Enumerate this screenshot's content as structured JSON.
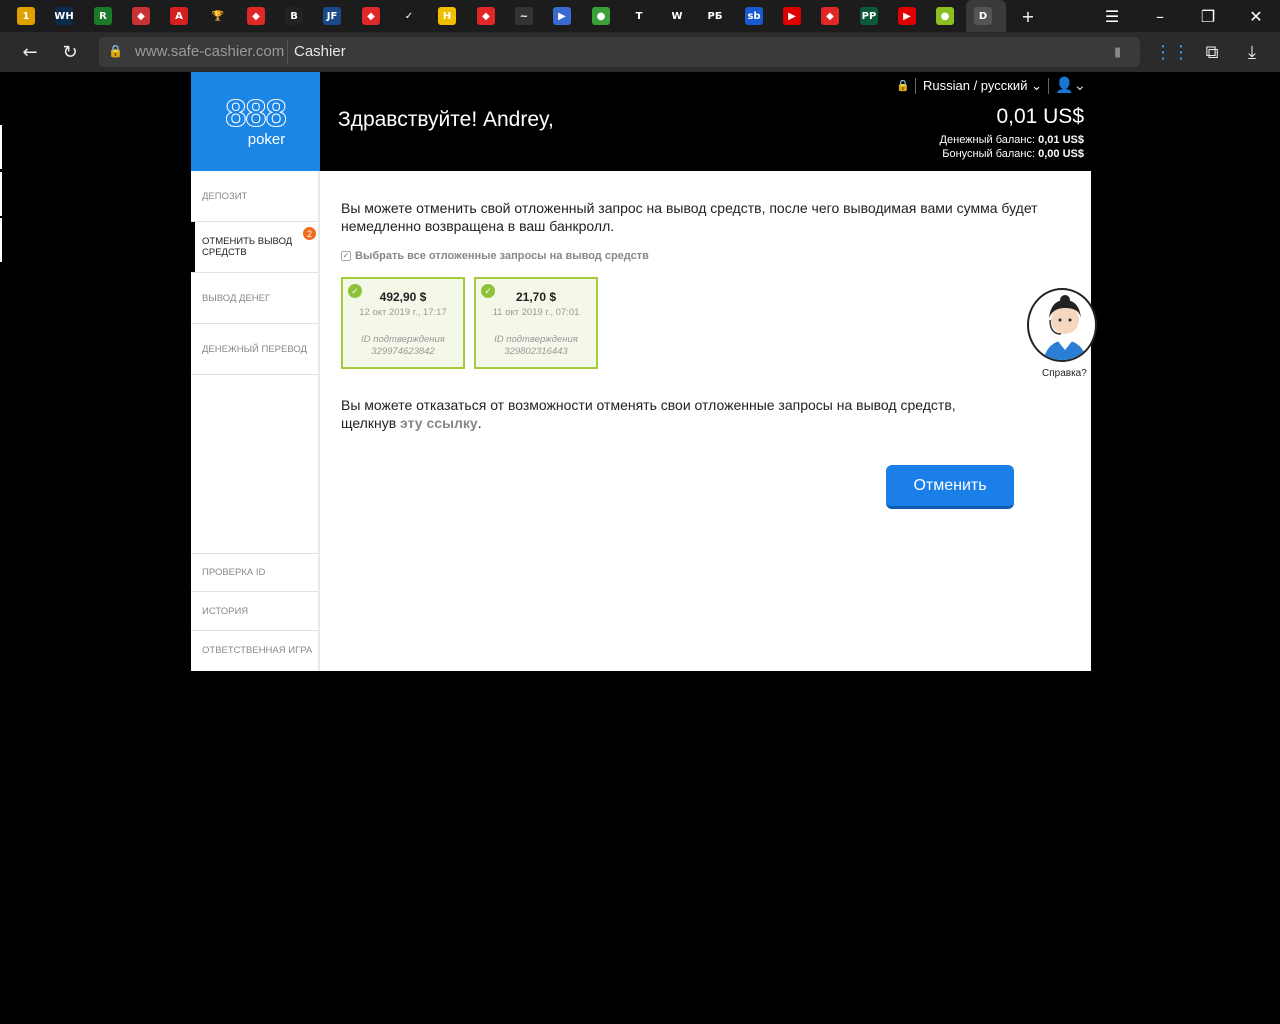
{
  "browser": {
    "url_host": "www.safe-cashier.com",
    "url_title": "Cashier",
    "tab_icons": [
      {
        "name": "mail-tab",
        "text": "1",
        "bg": "#e0a000"
      },
      {
        "name": "william-hill-tab",
        "text": "WH",
        "bg": "#0b2b4a"
      },
      {
        "name": "green-r-tab",
        "text": "R",
        "bg": "#1a7a2a"
      },
      {
        "name": "red-diamond-tab",
        "text": "◆",
        "bg": "#c83232"
      },
      {
        "name": "red-a-tab",
        "text": "A",
        "bg": "#d42020"
      },
      {
        "name": "trophy-tab",
        "text": "🏆",
        "bg": "#1c1c1c"
      },
      {
        "name": "fonbet-tab-1",
        "text": "◆",
        "bg": "#e02828"
      },
      {
        "name": "bb-tab",
        "text": "B",
        "bg": "#222"
      },
      {
        "name": "jf-tab",
        "text": "JF",
        "bg": "#1a4a8a"
      },
      {
        "name": "fonbet-tab-2",
        "text": "◆",
        "bg": "#e02828"
      },
      {
        "name": "check-tab",
        "text": "✓",
        "bg": "#1c1c1c"
      },
      {
        "name": "h-tab",
        "text": "H",
        "bg": "#f0c000"
      },
      {
        "name": "fonbet-tab-3",
        "text": "◆",
        "bg": "#e02828"
      },
      {
        "name": "dark-tab",
        "text": "~",
        "bg": "#333"
      },
      {
        "name": "play-tab",
        "text": "▶",
        "bg": "#3a6ad0"
      },
      {
        "name": "green-circle-tab",
        "text": "●",
        "bg": "#3aa03a"
      },
      {
        "name": "t-tab",
        "text": "T",
        "bg": "#1c1c1c"
      },
      {
        "name": "w-tab",
        "text": "W",
        "bg": "#1c1c1c"
      },
      {
        "name": "rb-tab",
        "text": "PБ",
        "bg": "#1c1c1c"
      },
      {
        "name": "sb-tab",
        "text": "sb",
        "bg": "#1a5ad0"
      },
      {
        "name": "youtube-tab-1",
        "text": "▶",
        "bg": "#e00000"
      },
      {
        "name": "fonbet-tab-4",
        "text": "◆",
        "bg": "#e02828"
      },
      {
        "name": "pp-tab",
        "text": "PP",
        "bg": "#0a5a3a"
      },
      {
        "name": "youtube-tab-2",
        "text": "▶",
        "bg": "#e00000"
      },
      {
        "name": "lime-tab",
        "text": "●",
        "bg": "#8ac020"
      },
      {
        "name": "active-tab",
        "text": "D",
        "bg": "#555"
      }
    ],
    "colors": {
      "accent": "#1b86e5",
      "card_border": "#a4cc3a",
      "badge": "#f26b1d"
    }
  },
  "header": {
    "logo_number": "888",
    "logo_word": "poker",
    "greeting": "Здравствуйте! Andrey,",
    "language": "Russian / русский",
    "balance": "0,01 US$",
    "cash_label": "Денежный баланс:",
    "cash_value": "0,01 US$",
    "bonus_label": "Бонусный баланс:",
    "bonus_value": "0,00 US$"
  },
  "sidebar": {
    "top_items": [
      {
        "label": "ДЕПОЗИТ"
      },
      {
        "label_1": "ОТМЕНИТЬ ВЫВОД",
        "label_2": "СРЕДСТВ",
        "badge": "2"
      },
      {
        "label": "ВЫВОД ДЕНЕГ"
      },
      {
        "label": "ДЕНЕЖНЫЙ ПЕРЕВОД"
      }
    ],
    "bottom_items": [
      {
        "label": "ПРОВЕРКА ID"
      },
      {
        "label": "ИСТОРИЯ"
      },
      {
        "label": "ОТВЕТСТВЕННАЯ ИГРА"
      }
    ]
  },
  "main": {
    "intro_1": "Вы можете отменить свой отложенный запрос на вывод средств, после чего выводимая вами сумма будет",
    "intro_2": "немедленно возвращена в ваш банкролл.",
    "select_all": "Выбрать все отложенные запросы на вывод средств",
    "requests": [
      {
        "amount": "492,90 $",
        "date": "12 окт 2019 г., 17:17",
        "id_label": "ID подтверждения",
        "id": "329974623842"
      },
      {
        "amount": "21,70 $",
        "date": "11 окт 2019 г., 07:01",
        "id_label": "ID подтверждения",
        "id": "329802316443"
      }
    ],
    "opt_out_1": "Вы можете отказаться от возможности отменять свои отложенные запросы на вывод средств,",
    "opt_out_2_prefix": "щелкнув ",
    "opt_out_link": "эту ссылку",
    "opt_out_2_suffix": ".",
    "cancel_button": "Отменить",
    "help_label": "Справка?"
  }
}
